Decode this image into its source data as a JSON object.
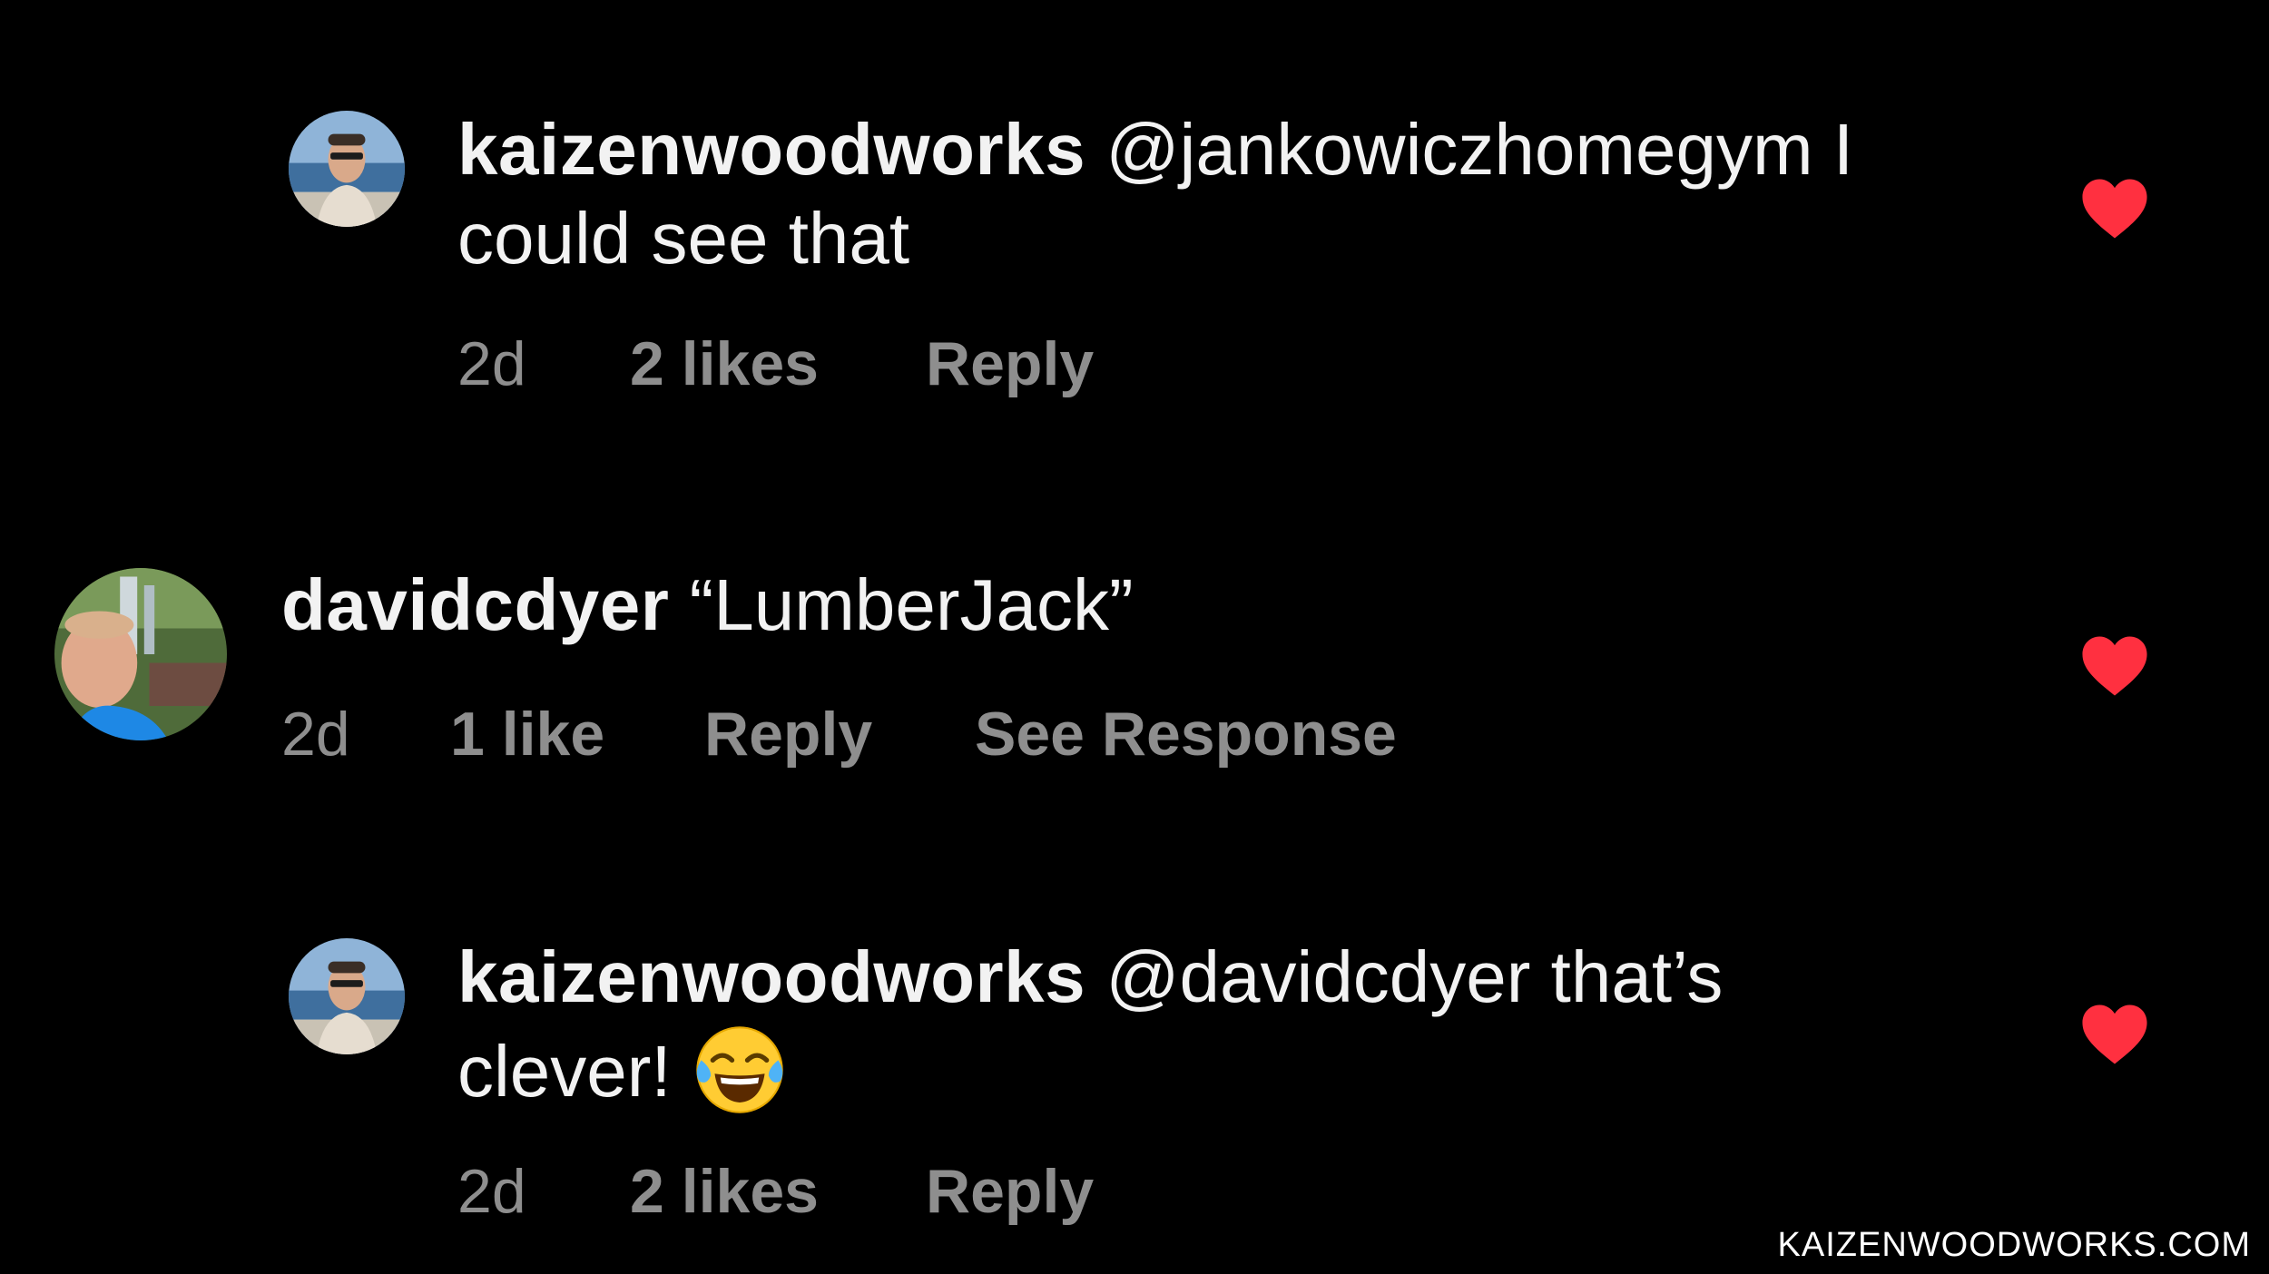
{
  "comments": [
    {
      "username": "kaizenwoodworks",
      "text_line1": "@jankowiczhomegym I",
      "text_line2": "could see that",
      "time": "2d",
      "likes": "2 likes",
      "reply": "Reply",
      "liked": true
    },
    {
      "username": "davidcdyer",
      "text_line1": "“LumberJack”",
      "time": "2d",
      "likes": "1 like",
      "reply": "Reply",
      "see_response": "See Response",
      "liked": true
    },
    {
      "username": "kaizenwoodworks",
      "text_line1": "@davidcdyer that’s",
      "text_line2": "clever!",
      "emoji": "face-with-tears-of-joy-emoji",
      "time": "2d",
      "likes": "2 likes",
      "reply": "Reply",
      "liked": true
    }
  ],
  "colors": {
    "background": "#000000",
    "text": "#f2f2f2",
    "meta": "#8e8e8e",
    "heart": "#ff3040"
  },
  "watermark": "KAIZENWOODWORKS.COM"
}
